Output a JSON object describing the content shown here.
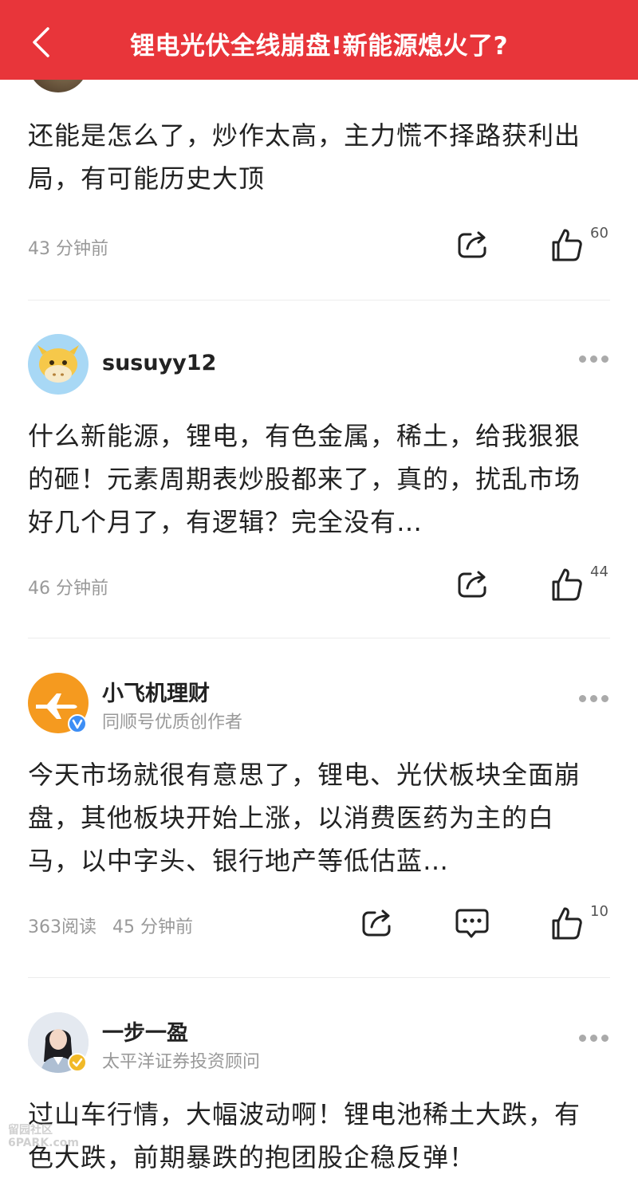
{
  "header": {
    "title": "锂电光伏全线崩盘!新能源熄火了?",
    "background": "#e8353a"
  },
  "comments": [
    {
      "text": "还能是怎么了，炒作太高，主力慌不择路获利出局，有可能历史大顶",
      "time": "43 分钟前",
      "likes": "60"
    },
    {
      "user": "susuyy12",
      "avatar": "cow-avatar",
      "text": "什么新能源，锂电，有色金属，稀土，给我狠狠的砸！元素周期表炒股都来了，真的，扰乱市场好几个月了，有逻辑？完全没有…",
      "time": "46 分钟前",
      "likes": "44"
    },
    {
      "user": "小飞机理财",
      "subtitle": "同顺号优质创作者",
      "avatar": "airplane-avatar",
      "badge": "V",
      "text": "今天市场就很有意思了，锂电、光伏板块全面崩盘，其他板块开始上涨，以消费医药为主的白马，以中字头、银行地产等低估蓝…",
      "reads": "363阅读",
      "time": "45 分钟前",
      "likes": "10"
    },
    {
      "user": "一步一盈",
      "subtitle": "太平洋证券投资顾问",
      "avatar": "woman-portrait-avatar",
      "text": "过山车行情，大幅波动啊！锂电池稀土大跌，有色大跌，前期暴跌的抱团股企稳反弹！"
    }
  ],
  "watermark": {
    "line1": "留园社区",
    "line2": "6PARK.com"
  }
}
